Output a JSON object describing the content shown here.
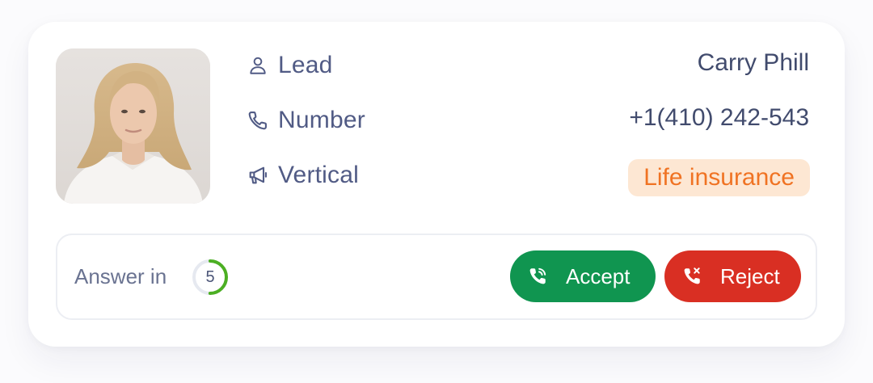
{
  "lead": {
    "label": "Lead",
    "value": "Carry Phill",
    "icon": "user-icon"
  },
  "number": {
    "label": "Number",
    "value": "+1(410) 242-543",
    "icon": "phone-icon"
  },
  "vertical": {
    "label": "Vertical",
    "value": "Life insurance",
    "icon": "megaphone-icon",
    "badge_bg": "#fde7d3",
    "badge_color": "#f07323"
  },
  "footer": {
    "answer_label": "Answer in",
    "countdown": "5",
    "countdown_progress": 0.5,
    "countdown_color": "#4caf23",
    "accept_label": "Accept",
    "reject_label": "Reject",
    "accept_color": "#109550",
    "reject_color": "#d92f23"
  }
}
